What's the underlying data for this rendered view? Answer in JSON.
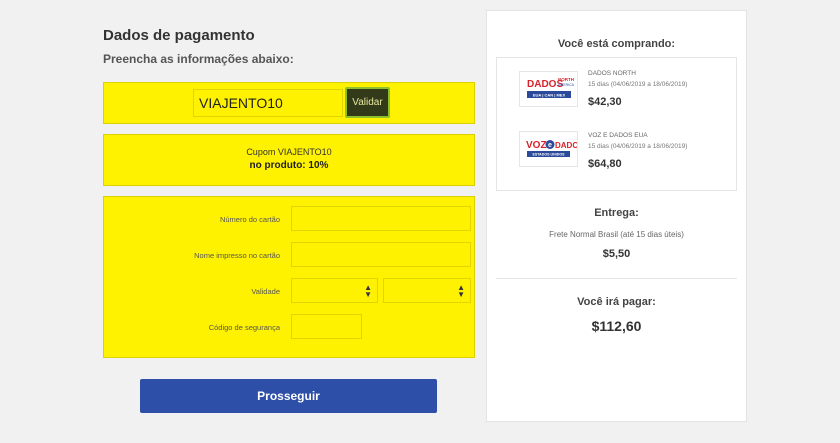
{
  "payment": {
    "title": "Dados de pagamento",
    "subtitle": "Preencha as informações abaixo:",
    "coupon_value": "VIAJENTO10",
    "validate_label": "Validar",
    "discount_line1": "Cupom VIAJENTO10",
    "discount_line2": "no produto: 10%",
    "fields": {
      "card_number_label": "Número do cartão",
      "card_name_label": "Nome impresso no cartão",
      "validity_label": "Validade",
      "security_code_label": "Código de segurança"
    },
    "proceed_label": "Prosseguir"
  },
  "summary": {
    "buying_title": "Você está comprando:",
    "products": [
      {
        "name": "DADOS NORTH",
        "dates": "15 dias (04/06/2019 a 18/06/2019)",
        "price": "$42,30",
        "logo_main": "DADOS",
        "logo_small_top": "NORTH",
        "logo_small_bottom": "AMERICA",
        "logo_bar": "EUA | CAN | MEX"
      },
      {
        "name": "VOZ E DADOS EUA",
        "dates": "15 dias (04/06/2019 a 18/06/2019)",
        "price": "$64,80",
        "logo_voz": "VOZ",
        "logo_e": "e",
        "logo_dados": "DADOS",
        "logo_bar": "ESTADOS UNIDOS"
      }
    ],
    "delivery_title": "Entrega:",
    "delivery_method": "Frete Normal Brasil (até 15 dias úteis)",
    "delivery_price": "$5,50",
    "total_title": "Você irá pagar:",
    "total_price": "$112,60"
  },
  "colors": {
    "highlight": "#fff200",
    "primary_button": "#2d4fa8",
    "logo_red": "#d9232a",
    "logo_blue": "#2b4a9b"
  },
  "icons": {
    "select_arrow": "updown-arrow-icon"
  }
}
